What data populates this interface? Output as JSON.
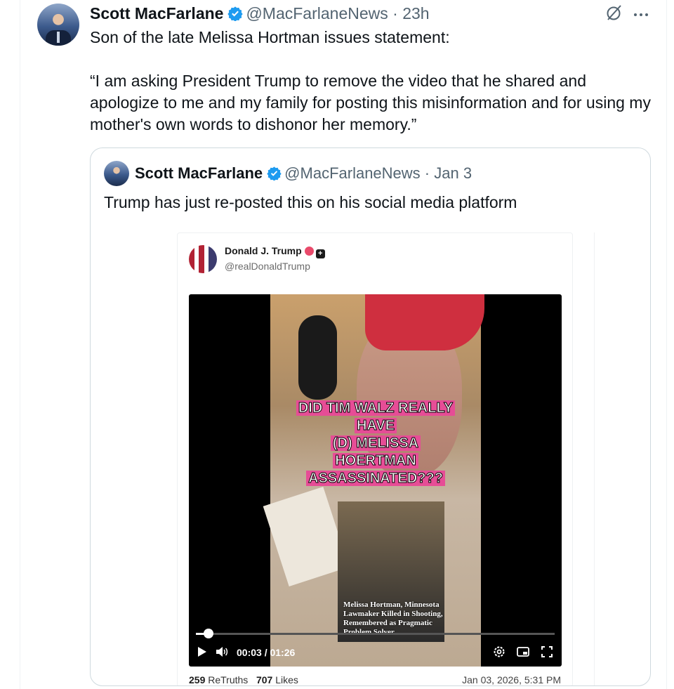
{
  "tweet": {
    "author_name": "Scott MacFarlane",
    "author_handle": "@MacFarlaneNews",
    "time": "23h",
    "text_line1": "Son of the late Melissa Hortman issues statement:",
    "quote_text": "“I am asking President Trump to remove the video that he shared and apologize to me and my family for posting this misinformation and for using my mother's own words to dishonor her memory.”"
  },
  "quoted_tweet": {
    "author_name": "Scott MacFarlane",
    "author_handle": "@MacFarlaneNews",
    "time": "Jan 3",
    "text": "Trump has just re-posted this on his social media platform"
  },
  "truth_post": {
    "author_name": "Donald J. Trump",
    "author_handle": "@realDonaldTrump",
    "video": {
      "overlay_lines": [
        "DID TIM WALZ REALLY",
        "HAVE",
        "(D) MELISSA",
        "HOERTMAN",
        "ASSASSINATED???"
      ],
      "caption": "Melissa Hortman, Minnesota Lawmaker Killed in Shooting, Remembered as Pragmatic Problem Solver",
      "time_current": "00:03",
      "time_total": "01:26",
      "progress_fraction": 0.035
    },
    "retruths_count": "259",
    "retruths_label": "ReTruths",
    "likes_count": "707",
    "likes_label": "Likes",
    "date": "Jan 03, 2026, 5:31 PM"
  },
  "colors": {
    "verified_blue": "#1d9bf0",
    "muted_text": "#536471",
    "overlay_pink": "#e64d96"
  },
  "icons": [
    "verified-badge-icon",
    "grok-icon",
    "more-icon",
    "play-icon",
    "volume-icon",
    "settings-icon",
    "pip-icon",
    "fullscreen-icon"
  ]
}
